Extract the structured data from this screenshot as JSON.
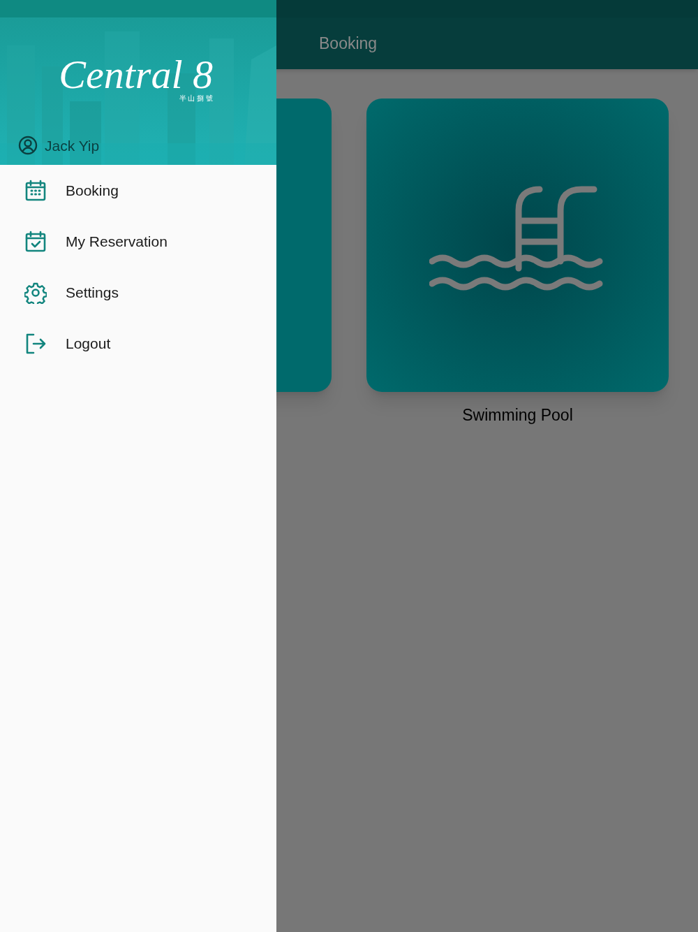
{
  "app_bar": {
    "title": "Booking"
  },
  "facilities": [
    {
      "label": "Swimming Pool"
    }
  ],
  "drawer": {
    "logo": {
      "wordmark": "Central 8",
      "subtitle": "半 山 捌 號"
    },
    "user": {
      "name": "Jack Yip"
    },
    "items": [
      {
        "label": "Booking"
      },
      {
        "label": "My Reservation"
      },
      {
        "label": "Settings"
      },
      {
        "label": "Logout"
      }
    ]
  }
}
